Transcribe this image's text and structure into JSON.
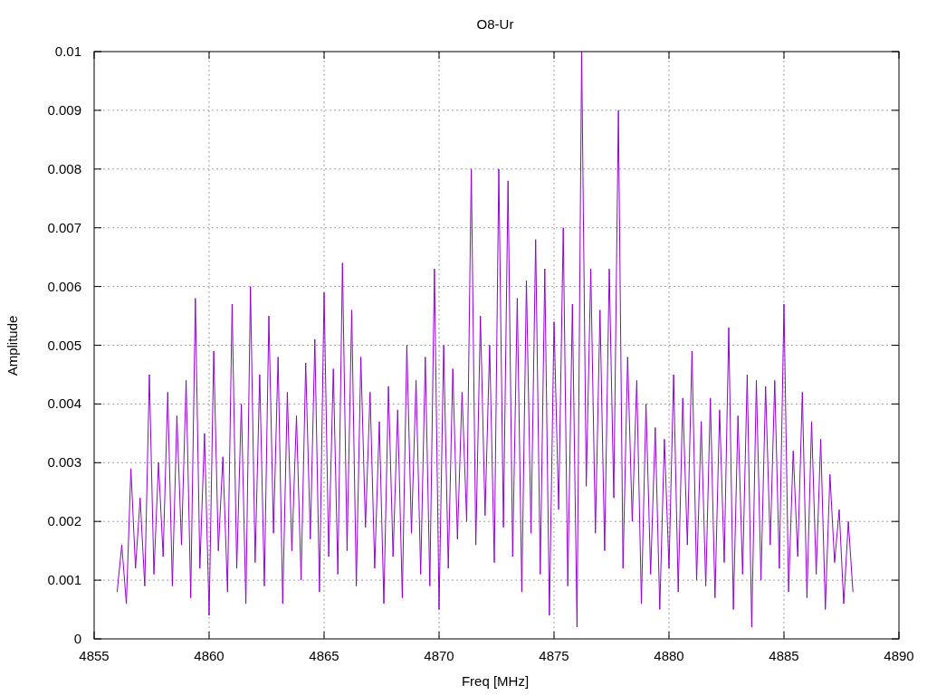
{
  "chart_data": {
    "type": "line",
    "title": "O8-Ur",
    "xlabel": "Freq [MHz]",
    "ylabel": "Amplitude",
    "xlim": [
      4855,
      4890
    ],
    "ylim": [
      0,
      0.01
    ],
    "grid": true,
    "xticks": [
      4855,
      4860,
      4865,
      4870,
      4875,
      4880,
      4885,
      4890
    ],
    "yticks": [
      0,
      0.001,
      0.002,
      0.003,
      0.004,
      0.005,
      0.006,
      0.007,
      0.008,
      0.009,
      0.01
    ],
    "x": [
      4856.0,
      4856.2,
      4856.4,
      4856.6,
      4856.8,
      4857.0,
      4857.2,
      4857.4,
      4857.6,
      4857.8,
      4858.0,
      4858.2,
      4858.4,
      4858.6,
      4858.8,
      4859.0,
      4859.2,
      4859.4,
      4859.6,
      4859.8,
      4860.0,
      4860.2,
      4860.4,
      4860.6,
      4860.8,
      4861.0,
      4861.2,
      4861.4,
      4861.6,
      4861.8,
      4862.0,
      4862.2,
      4862.4,
      4862.6,
      4862.8,
      4863.0,
      4863.2,
      4863.4,
      4863.6,
      4863.8,
      4864.0,
      4864.2,
      4864.4,
      4864.6,
      4864.8,
      4865.0,
      4865.2,
      4865.4,
      4865.6,
      4865.8,
      4866.0,
      4866.2,
      4866.4,
      4866.6,
      4866.8,
      4867.0,
      4867.2,
      4867.4,
      4867.6,
      4867.8,
      4868.0,
      4868.2,
      4868.4,
      4868.6,
      4868.8,
      4869.0,
      4869.2,
      4869.4,
      4869.6,
      4869.8,
      4870.0,
      4870.2,
      4870.4,
      4870.6,
      4870.8,
      4871.0,
      4871.2,
      4871.4,
      4871.6,
      4871.8,
      4872.0,
      4872.2,
      4872.4,
      4872.6,
      4872.8,
      4873.0,
      4873.2,
      4873.4,
      4873.6,
      4873.8,
      4874.0,
      4874.2,
      4874.4,
      4874.6,
      4874.8,
      4875.0,
      4875.2,
      4875.4,
      4875.6,
      4875.8,
      4876.0,
      4876.2,
      4876.4,
      4876.6,
      4876.8,
      4877.0,
      4877.2,
      4877.4,
      4877.6,
      4877.8,
      4878.0,
      4878.2,
      4878.4,
      4878.6,
      4878.8,
      4879.0,
      4879.2,
      4879.4,
      4879.6,
      4879.8,
      4880.0,
      4880.2,
      4880.4,
      4880.6,
      4880.8,
      4881.0,
      4881.2,
      4881.4,
      4881.6,
      4881.8,
      4882.0,
      4882.2,
      4882.4,
      4882.6,
      4882.8,
      4883.0,
      4883.2,
      4883.4,
      4883.6,
      4883.8,
      4884.0,
      4884.2,
      4884.4,
      4884.6,
      4884.8,
      4885.0,
      4885.2,
      4885.4,
      4885.6,
      4885.8,
      4886.0,
      4886.2,
      4886.4,
      4886.6,
      4886.8,
      4887.0,
      4887.2,
      4887.4,
      4887.6,
      4887.8,
      4888.0
    ],
    "series": [
      {
        "color": "#9400d3",
        "values": [
          0.0008,
          0.0016,
          0.0006,
          0.0029,
          0.0012,
          0.0024,
          0.0009,
          0.0045,
          0.0011,
          0.003,
          0.0014,
          0.0042,
          0.0009,
          0.0038,
          0.0016,
          0.0044,
          0.0007,
          0.0058,
          0.0012,
          0.0035,
          0.0004,
          0.0049,
          0.0015,
          0.0031,
          0.0008,
          0.0057,
          0.0012,
          0.004,
          0.0006,
          0.006,
          0.0013,
          0.0045,
          0.0009,
          0.0055,
          0.0018,
          0.0048,
          0.0006,
          0.0042,
          0.0015,
          0.0038,
          0.001,
          0.0047,
          0.0017,
          0.0051,
          0.0008,
          0.0059,
          0.0014,
          0.0046,
          0.0011,
          0.0064,
          0.0015,
          0.0056,
          0.0009,
          0.0048,
          0.0019,
          0.0042,
          0.0012,
          0.0037,
          0.0006,
          0.0043,
          0.0014,
          0.0039,
          0.0007,
          0.005,
          0.0018,
          0.0044,
          0.0011,
          0.0048,
          0.0009,
          0.0063,
          0.0005,
          0.005,
          0.0012,
          0.0046,
          0.0017,
          0.0042,
          0.002,
          0.008,
          0.0016,
          0.0055,
          0.0021,
          0.005,
          0.0013,
          0.008,
          0.0019,
          0.0078,
          0.0014,
          0.0058,
          0.0008,
          0.0061,
          0.0018,
          0.0068,
          0.0011,
          0.0063,
          0.0004,
          0.0054,
          0.0022,
          0.007,
          0.0009,
          0.0057,
          0.0002,
          0.01,
          0.0026,
          0.0063,
          0.0018,
          0.0056,
          0.0015,
          0.0063,
          0.0024,
          0.009,
          0.0012,
          0.0048,
          0.002,
          0.0044,
          0.0006,
          0.004,
          0.0011,
          0.0036,
          0.0005,
          0.0034,
          0.0012,
          0.0045,
          0.0008,
          0.0041,
          0.0016,
          0.0049,
          0.001,
          0.0037,
          0.0009,
          0.0041,
          0.0007,
          0.0039,
          0.0013,
          0.0053,
          0.0005,
          0.0038,
          0.0011,
          0.0045,
          0.0002,
          0.0044,
          0.001,
          0.0043,
          0.0016,
          0.0044,
          0.0012,
          0.0057,
          0.0008,
          0.0032,
          0.0014,
          0.0042,
          0.0007,
          0.0037,
          0.0011,
          0.0034,
          0.0005,
          0.0028,
          0.0013,
          0.0022,
          0.0006,
          0.002,
          0.0008
        ]
      }
    ]
  }
}
